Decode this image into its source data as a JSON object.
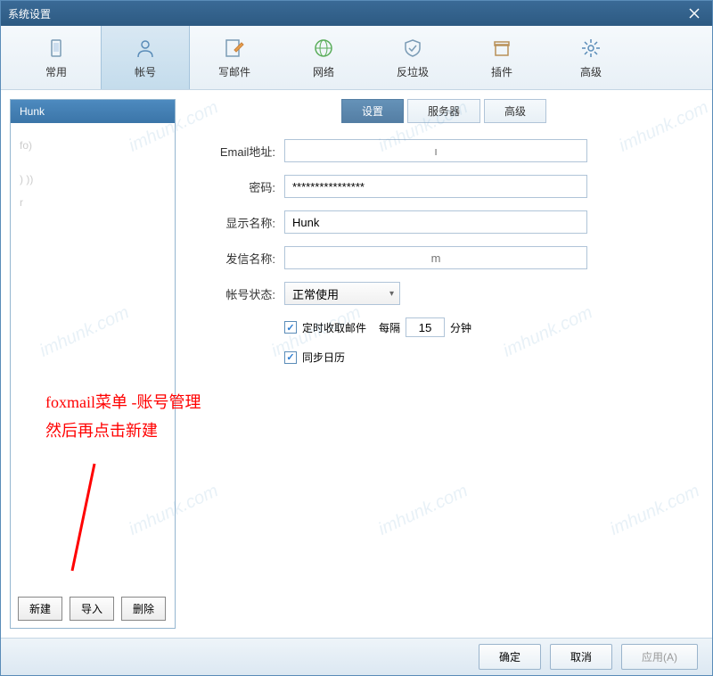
{
  "title": "系统设置",
  "toolbar": [
    {
      "name": "general",
      "label": "常用",
      "icon": "device"
    },
    {
      "name": "account",
      "label": "帐号",
      "icon": "user",
      "active": true
    },
    {
      "name": "compose",
      "label": "写邮件",
      "icon": "edit"
    },
    {
      "name": "network",
      "label": "网络",
      "icon": "globe"
    },
    {
      "name": "antispam",
      "label": "反垃圾",
      "icon": "shield"
    },
    {
      "name": "plugins",
      "label": "插件",
      "icon": "box"
    },
    {
      "name": "advanced",
      "label": "高级",
      "icon": "gear"
    }
  ],
  "accounts": [
    {
      "label": "Hunk",
      "selected": true
    },
    {
      "label": " "
    },
    {
      "label": "                  fo)",
      "light": true
    },
    {
      "label": " "
    },
    {
      "label": "                )  ))",
      "light": true
    },
    {
      "label": "r",
      "light": true
    }
  ],
  "sidebar_btns": {
    "new": "新建",
    "import": "导入",
    "delete": "删除"
  },
  "tabs": {
    "settings": "设置",
    "server": "服务器",
    "advanced": "高级"
  },
  "form": {
    "email_label": "Email地址:",
    "email_value": "",
    "email_placeholder": "ı",
    "password_label": "密码:",
    "password_value": "****************",
    "display_label": "显示名称:",
    "display_value": "Hunk",
    "sender_label": "发信名称:",
    "sender_value": "",
    "sender_placeholder": "m",
    "status_label": "帐号状态:",
    "status_value": "正常使用",
    "fetch_label": "定时收取邮件",
    "interval_prefix": "每隔",
    "interval_value": "15",
    "interval_suffix": "分钟",
    "sync_label": "同步日历"
  },
  "annotations": {
    "line1": "foxmail菜单 -账号管理",
    "line2": "然后再点击新建"
  },
  "dialog": {
    "ok": "确定",
    "cancel": "取消",
    "apply": "应用(A)"
  },
  "watermark": "imhunk.com"
}
